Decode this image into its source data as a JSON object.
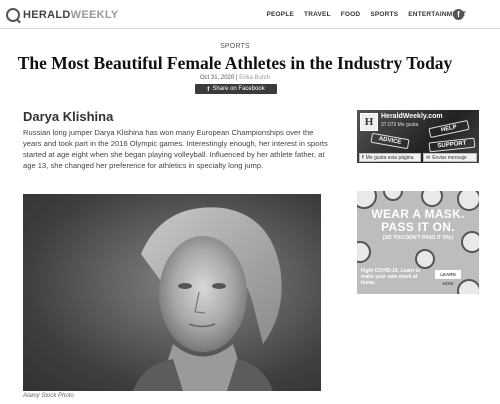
{
  "nav": {
    "logo_bold": "HERALD",
    "logo_light": "WEEKLY",
    "links": [
      "PEOPLE",
      "TRAVEL",
      "FOOD",
      "SPORTS",
      "ENTERTAINMENT"
    ],
    "facebook_glyph": "f"
  },
  "article": {
    "category": "SPORTS",
    "title": "The Most Beautiful Female Athletes in the Industry Today",
    "date": "Oct 31, 2020",
    "separator": " | ",
    "author": "Erika Burch",
    "share_label": "Share on Facebook",
    "athlete_name": "Darya Klishina",
    "body": "Russian long jumper Darya Klishina has won many European Championships over the years and took part in the 2016 Olympic games. Interestingly enough, her interest in sports started at age eight when she began playing volleyball. Influenced by her athlete father, at age 13, she changed her preference for athletics in specialty long jump.",
    "photo_caption": "Alamy Stock Photo"
  },
  "sidebar": {
    "fb_widget": {
      "page_name": "HeraldWeekly.com",
      "likes": "37.073 Me gusta",
      "thumb_letter": "H",
      "signs": [
        "HELP",
        "ADVICE",
        "SUPPORT"
      ],
      "like_label": "Me gusta esta página",
      "message_label": "Enviar mensaje"
    },
    "ad": {
      "headline_line1": "WEAR A MASK.",
      "headline_line2": "PASS IT ON.",
      "subline": "(SO YOU DON'T PASS IT ON.)",
      "footer": "Fight COVID-19. Learn to make your own mask at home.",
      "cta": "LEARN HOW"
    }
  }
}
